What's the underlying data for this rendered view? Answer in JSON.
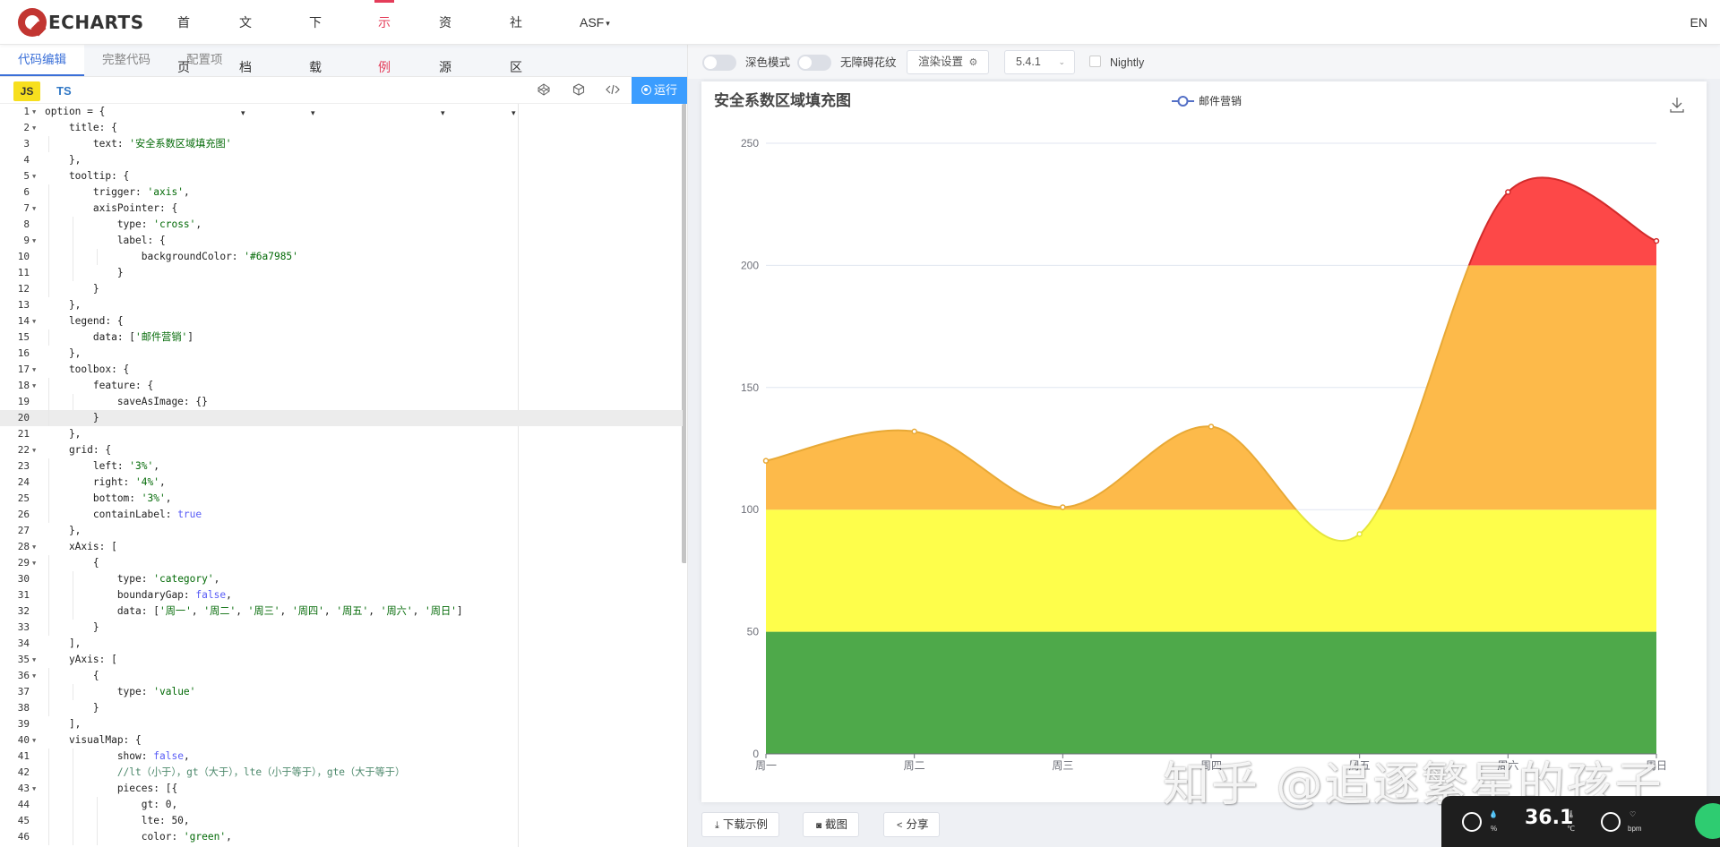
{
  "nav": {
    "logo_text": "ECHARTS",
    "items": [
      {
        "label": "首页",
        "caret": false,
        "active": false
      },
      {
        "label": "文档",
        "caret": true,
        "active": false
      },
      {
        "label": "下载",
        "caret": true,
        "active": false
      },
      {
        "label": "示例",
        "caret": false,
        "active": true
      },
      {
        "label": "资源",
        "caret": true,
        "active": false
      },
      {
        "label": "社区",
        "caret": true,
        "active": false
      },
      {
        "label": "ASF",
        "caret": true,
        "active": false
      }
    ],
    "lang": "EN"
  },
  "editor": {
    "tabs": [
      "代码编辑",
      "完整代码",
      "配置项"
    ],
    "lang_js": "JS",
    "lang_ts": "TS",
    "run_label": "运行",
    "active_line": 20,
    "lines": [
      "option = {",
      "    title: {",
      "        text: '安全系数区域填充图'",
      "    },",
      "    tooltip: {",
      "        trigger: 'axis',",
      "        axisPointer: {",
      "            type: 'cross',",
      "            label: {",
      "                backgroundColor: '#6a7985'",
      "            }",
      "        }",
      "    },",
      "    legend: {",
      "        data: ['邮件营销']",
      "    },",
      "    toolbox: {",
      "        feature: {",
      "            saveAsImage: {}",
      "        }",
      "    },",
      "    grid: {",
      "        left: '3%',",
      "        right: '4%',",
      "        bottom: '3%',",
      "        containLabel: true",
      "    },",
      "    xAxis: [",
      "        {",
      "            type: 'category',",
      "            boundaryGap: false,",
      "            data: ['周一', '周二', '周三', '周四', '周五', '周六', '周日']",
      "        }",
      "    ],",
      "    yAxis: [",
      "        {",
      "            type: 'value'",
      "        }",
      "    ],",
      "    visualMap: {",
      "            show: false,",
      "            //lt（小于），gt（大于），lte（小于等于），gte（大于等于）",
      "            pieces: [{",
      "                gt: 0,",
      "                lte: 50,",
      "                color: 'green',"
    ],
    "fold_lines": [
      1,
      2,
      5,
      7,
      9,
      14,
      17,
      18,
      22,
      28,
      29,
      35,
      36,
      40,
      43
    ]
  },
  "controls": {
    "dark_mode": "深色模式",
    "accessible": "无障碍花纹",
    "render_settings": "渲染设置",
    "version": "5.4.1",
    "nightly": "Nightly"
  },
  "chart_data": {
    "type": "line",
    "title": "安全系数区域填充图",
    "legend": [
      "邮件营销"
    ],
    "legend_position": "top-center",
    "categories": [
      "周一",
      "周二",
      "周三",
      "周四",
      "周五",
      "周六",
      "周日"
    ],
    "series": [
      {
        "name": "邮件营销",
        "values": [
          120,
          132,
          101,
          134,
          90,
          230,
          210
        ],
        "smooth": true
      }
    ],
    "ylim": [
      0,
      250
    ],
    "yticks": [
      0,
      50,
      100,
      150,
      200,
      250
    ],
    "grid": true,
    "visual_pieces": [
      {
        "gt": 0,
        "lte": 50,
        "color": "#4ea94a"
      },
      {
        "gt": 50,
        "lte": 100,
        "color": "#fefe4b"
      },
      {
        "gt": 100,
        "lte": 200,
        "color": "#fdba4a"
      },
      {
        "gt": 200,
        "color": "#fd4848"
      }
    ],
    "line_colors": [
      "#4ea94a",
      "#e5e53c",
      "#e8a936",
      "#d22b2b"
    ]
  },
  "bottom_bar": {
    "download": "下载示例",
    "screenshot": "截图",
    "share": "分享"
  },
  "watermark": "知乎 @追逐繁星的孩子",
  "widget": {
    "temp": "36.1",
    "temp_unit": "℃",
    "unit_pct": "%",
    "unit_bpm": "bpm"
  }
}
